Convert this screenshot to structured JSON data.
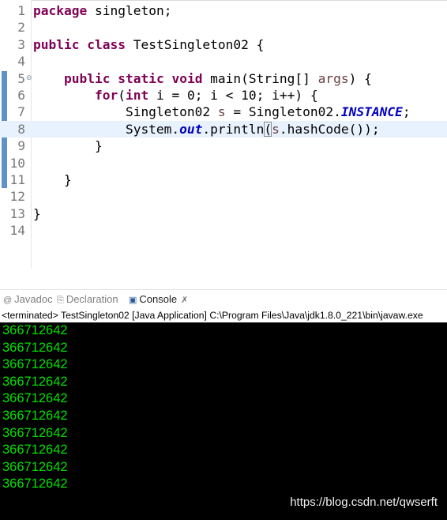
{
  "editor": {
    "lines": [
      {
        "n": "1",
        "code": [
          "kw:package",
          " singleton;"
        ]
      },
      {
        "n": "2",
        "code": []
      },
      {
        "n": "3",
        "code": [
          "kw:public",
          " ",
          "kw:class",
          " TestSingleton02 {"
        ]
      },
      {
        "n": "4",
        "code": []
      },
      {
        "n": "5",
        "fold": "⊖",
        "code": [
          "    ",
          "kw:public",
          " ",
          "kw:static",
          " ",
          "kw:void",
          " main(String[] ",
          "var:args",
          ") {"
        ]
      },
      {
        "n": "6",
        "code": [
          "        ",
          "kw:for",
          "(",
          "kw:int",
          " i = 0; i < 10; i++) {"
        ]
      },
      {
        "n": "7",
        "code": [
          "            Singleton02 ",
          "var:s",
          " = Singleton02.",
          "field:INSTANCE",
          ";"
        ]
      },
      {
        "n": "8",
        "current": true,
        "code": [
          "            System.",
          "field:out",
          ".println",
          "box:(",
          "var:s",
          ".hashCode());"
        ]
      },
      {
        "n": "9",
        "code": [
          "        }"
        ]
      },
      {
        "n": "10",
        "code": []
      },
      {
        "n": "11",
        "code": [
          "    }"
        ]
      },
      {
        "n": "12",
        "code": []
      },
      {
        "n": "13",
        "code": [
          "}"
        ]
      },
      {
        "n": "14",
        "code": []
      }
    ],
    "scroll_left_glyph": "<"
  },
  "views": {
    "tabs": [
      {
        "label": "Javadoc",
        "icon": "@",
        "icon_name": "at-icon",
        "active": false
      },
      {
        "label": "Declaration",
        "icon": "⎘",
        "icon_name": "declaration-icon",
        "active": false
      },
      {
        "label": "Console",
        "icon": "▣",
        "icon_name": "console-icon",
        "active": true,
        "close": "✗"
      }
    ]
  },
  "console": {
    "header": "<terminated> TestSingleton02 [Java Application] C:\\Program Files\\Java\\jdk1.8.0_221\\bin\\javaw.exe",
    "output": [
      "366712642",
      "366712642",
      "366712642",
      "366712642",
      "366712642",
      "366712642",
      "366712642",
      "366712642",
      "366712642",
      "366712642"
    ],
    "watermark": "https://blog.csdn.net/qwserft"
  },
  "colors": {
    "keyword": "#7f0055",
    "local_var": "#6a3e3e",
    "static_field": "#0000c0",
    "current_line": "#e8f2fe",
    "console_bg": "#000000",
    "console_text": "#00e000",
    "ruler_mark": "#5e92c8"
  }
}
